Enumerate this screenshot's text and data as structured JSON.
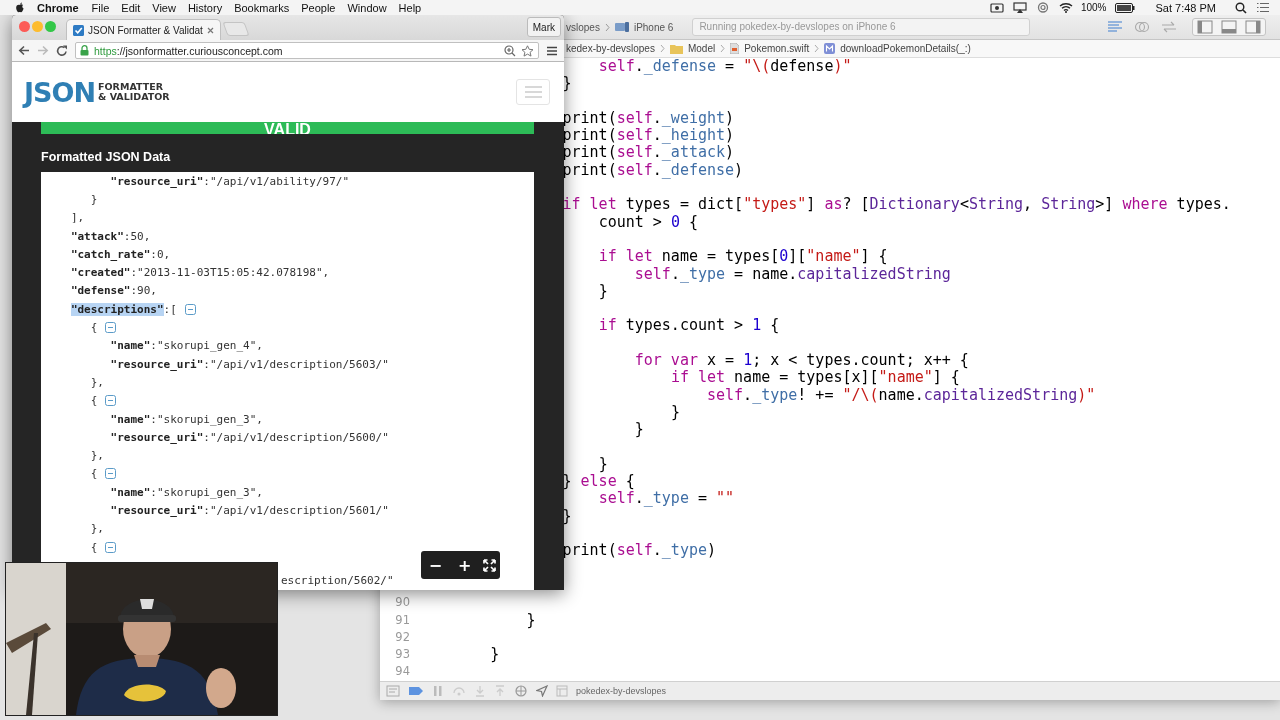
{
  "menu_bar": {
    "app": "Chrome",
    "items": [
      "File",
      "Edit",
      "View",
      "History",
      "Bookmarks",
      "People",
      "Window",
      "Help"
    ],
    "battery": "100%",
    "clock": "Sat 7:48 PM"
  },
  "xcode": {
    "toolbar": {
      "scheme": "vslopes",
      "device": "iPhone 6",
      "status": "Running pokedex-by-devslopes on iPhone 6"
    },
    "breadcrumbs": [
      {
        "kind": "project",
        "label": "kedex-by-devslopes"
      },
      {
        "kind": "folder",
        "label": "Model"
      },
      {
        "kind": "file",
        "label": "Pokemon.swift"
      },
      {
        "kind": "method",
        "label": "downloadPokemonDetails(_:)"
      }
    ],
    "lines": [
      {
        "kind": "code",
        "tokens": [
          {
            "kind": "keyword",
            "text": "                    self"
          },
          {
            "kind": "plain",
            "text": "."
          },
          {
            "kind": "member",
            "text": "_defense"
          },
          {
            "kind": "plain",
            "text": " = "
          },
          {
            "kind": "string",
            "text": "\"\\("
          },
          {
            "kind": "plain",
            "text": "defense"
          },
          {
            "kind": "string",
            "text": ")\""
          }
        ]
      },
      {
        "kind": "code",
        "tokens": [
          {
            "kind": "plain",
            "text": "                }"
          }
        ]
      },
      {
        "kind": "blank"
      },
      {
        "kind": "code",
        "tokens": [
          {
            "kind": "plain",
            "text": "                print("
          },
          {
            "kind": "keyword",
            "text": "self"
          },
          {
            "kind": "plain",
            "text": "."
          },
          {
            "kind": "member",
            "text": "_weight"
          },
          {
            "kind": "plain",
            "text": ")"
          }
        ]
      },
      {
        "kind": "code",
        "tokens": [
          {
            "kind": "plain",
            "text": "                print("
          },
          {
            "kind": "keyword",
            "text": "self"
          },
          {
            "kind": "plain",
            "text": "."
          },
          {
            "kind": "member",
            "text": "_height"
          },
          {
            "kind": "plain",
            "text": ")"
          }
        ]
      },
      {
        "kind": "code",
        "tokens": [
          {
            "kind": "plain",
            "text": "                print("
          },
          {
            "kind": "keyword",
            "text": "self"
          },
          {
            "kind": "plain",
            "text": "."
          },
          {
            "kind": "member",
            "text": "_attack"
          },
          {
            "kind": "plain",
            "text": ")"
          }
        ]
      },
      {
        "kind": "code",
        "tokens": [
          {
            "kind": "plain",
            "text": "                print("
          },
          {
            "kind": "keyword",
            "text": "self"
          },
          {
            "kind": "plain",
            "text": "."
          },
          {
            "kind": "member",
            "text": "_defense"
          },
          {
            "kind": "plain",
            "text": ")"
          }
        ]
      },
      {
        "kind": "blank"
      },
      {
        "kind": "code",
        "tokens": [
          {
            "kind": "keyword",
            "text": "                if let"
          },
          {
            "kind": "plain",
            "text": " types = dict["
          },
          {
            "kind": "string",
            "text": "\"types\""
          },
          {
            "kind": "plain",
            "text": "] "
          },
          {
            "kind": "keyword",
            "text": "as"
          },
          {
            "kind": "plain",
            "text": "? ["
          },
          {
            "kind": "type",
            "text": "Dictionary"
          },
          {
            "kind": "plain",
            "text": "<"
          },
          {
            "kind": "type",
            "text": "String"
          },
          {
            "kind": "plain",
            "text": ", "
          },
          {
            "kind": "type",
            "text": "String"
          },
          {
            "kind": "plain",
            "text": ">] "
          },
          {
            "kind": "keyword",
            "text": "where"
          },
          {
            "kind": "plain",
            "text": " types."
          }
        ]
      },
      {
        "kind": "code",
        "tokens": [
          {
            "kind": "plain",
            "text": "                    count > "
          },
          {
            "kind": "number",
            "text": "0"
          },
          {
            "kind": "plain",
            "text": " {"
          }
        ]
      },
      {
        "kind": "blank"
      },
      {
        "kind": "code",
        "tokens": [
          {
            "kind": "keyword",
            "text": "                    if let"
          },
          {
            "kind": "plain",
            "text": " name = types["
          },
          {
            "kind": "number",
            "text": "0"
          },
          {
            "kind": "plain",
            "text": "]["
          },
          {
            "kind": "string",
            "text": "\"name\""
          },
          {
            "kind": "plain",
            "text": "] {"
          }
        ]
      },
      {
        "kind": "code",
        "tokens": [
          {
            "kind": "keyword",
            "text": "                        self"
          },
          {
            "kind": "plain",
            "text": "."
          },
          {
            "kind": "member",
            "text": "_type"
          },
          {
            "kind": "plain",
            "text": " = name."
          },
          {
            "kind": "type",
            "text": "capitalizedString"
          }
        ]
      },
      {
        "kind": "code",
        "tokens": [
          {
            "kind": "plain",
            "text": "                    }"
          }
        ]
      },
      {
        "kind": "blank"
      },
      {
        "kind": "code",
        "tokens": [
          {
            "kind": "keyword",
            "text": "                    if"
          },
          {
            "kind": "plain",
            "text": " types.count > "
          },
          {
            "kind": "number",
            "text": "1"
          },
          {
            "kind": "plain",
            "text": " {"
          }
        ]
      },
      {
        "kind": "blank"
      },
      {
        "kind": "code",
        "tokens": [
          {
            "kind": "keyword",
            "text": "                        for var"
          },
          {
            "kind": "plain",
            "text": " x = "
          },
          {
            "kind": "number",
            "text": "1"
          },
          {
            "kind": "plain",
            "text": "; x < types.count; x++ {"
          }
        ]
      },
      {
        "kind": "code",
        "tokens": [
          {
            "kind": "keyword",
            "text": "                            if let"
          },
          {
            "kind": "plain",
            "text": " name = types[x]["
          },
          {
            "kind": "string",
            "text": "\"name\""
          },
          {
            "kind": "plain",
            "text": "] {"
          }
        ]
      },
      {
        "kind": "code",
        "tokens": [
          {
            "kind": "keyword",
            "text": "                                self"
          },
          {
            "kind": "plain",
            "text": "."
          },
          {
            "kind": "member",
            "text": "_type"
          },
          {
            "kind": "plain",
            "text": "! += "
          },
          {
            "kind": "string",
            "text": "\"/\\("
          },
          {
            "kind": "plain",
            "text": "name."
          },
          {
            "kind": "type",
            "text": "capitalizedString"
          },
          {
            "kind": "string",
            "text": ")\""
          }
        ]
      },
      {
        "kind": "code",
        "tokens": [
          {
            "kind": "plain",
            "text": "                            }"
          }
        ]
      },
      {
        "kind": "code",
        "tokens": [
          {
            "kind": "plain",
            "text": "                        }"
          }
        ]
      },
      {
        "kind": "blank"
      },
      {
        "kind": "code",
        "tokens": [
          {
            "kind": "plain",
            "text": "                    }"
          }
        ]
      },
      {
        "kind": "code",
        "tokens": [
          {
            "kind": "plain",
            "text": "                } "
          },
          {
            "kind": "keyword",
            "text": "else"
          },
          {
            "kind": "plain",
            "text": " {"
          }
        ]
      },
      {
        "kind": "code",
        "tokens": [
          {
            "kind": "keyword",
            "text": "                    self"
          },
          {
            "kind": "plain",
            "text": "."
          },
          {
            "kind": "member",
            "text": "_type"
          },
          {
            "kind": "plain",
            "text": " = "
          },
          {
            "kind": "string",
            "text": "\"\""
          }
        ]
      },
      {
        "kind": "code",
        "tokens": [
          {
            "kind": "plain",
            "text": "                }"
          }
        ]
      },
      {
        "kind": "blank"
      },
      {
        "kind": "code",
        "tokens": [
          {
            "kind": "plain",
            "text": "                print("
          },
          {
            "kind": "keyword",
            "text": "self"
          },
          {
            "kind": "plain",
            "text": "."
          },
          {
            "kind": "member",
            "text": "_type"
          },
          {
            "kind": "plain",
            "text": ")"
          }
        ]
      },
      {
        "kind": "blank"
      },
      {
        "kind": "blank"
      },
      {
        "kind": "blank",
        "number": "90"
      },
      {
        "kind": "code",
        "number": "91",
        "tokens": [
          {
            "kind": "plain",
            "text": "            }"
          }
        ]
      },
      {
        "kind": "blank",
        "number": "92"
      },
      {
        "kind": "code",
        "number": "93",
        "tokens": [
          {
            "kind": "plain",
            "text": "        }"
          }
        ]
      },
      {
        "kind": "blank",
        "number": "94"
      }
    ],
    "debug_bar": {
      "target": "pokedex-by-devslopes"
    }
  },
  "chrome": {
    "tab": {
      "title": "JSON Formatter & Validat"
    },
    "profile": "Mark",
    "url": {
      "scheme": "https",
      "rest": "://jsonformatter.curiousconcept.com"
    },
    "page": {
      "logo": {
        "main": "JSON",
        "line_1": "FORMATTER",
        "line_2": "& VALIDATOR"
      },
      "status": "VALID",
      "section_title": "Formatted JSON Data",
      "json_lines": [
        {
          "key": "         \"resource_uri\"",
          "value": ":\"/api/v1/ability/97/\"",
          "selected": false
        },
        {
          "value": "      }",
          "selected": false
        },
        {
          "value": "   ],",
          "selected": false
        },
        {
          "key": "   \"attack\"",
          "value": ":50,",
          "selected": false
        },
        {
          "key": "   \"catch_rate\"",
          "value": ":0,",
          "selected": false
        },
        {
          "key": "   \"created\"",
          "value": ":\"2013-11-03T15:05:42.078198\",",
          "selected": false
        },
        {
          "key": "   \"defense\"",
          "value": ":90,",
          "selected": false
        },
        {
          "key": "   \"descriptions\"",
          "value": ":[",
          "selected": true,
          "expanded": true
        },
        {
          "value": "      {",
          "selected": false,
          "expanded": true
        },
        {
          "key": "         \"name\"",
          "value": ":\"skorupi_gen_4\",",
          "selected": false
        },
        {
          "key": "         \"resource_uri\"",
          "value": ":\"/api/v1/description/5603/\"",
          "selected": false
        },
        {
          "value": "      },",
          "selected": false
        },
        {
          "value": "      {",
          "selected": false,
          "expanded": true
        },
        {
          "key": "         \"name\"",
          "value": ":\"skorupi_gen_3\",",
          "selected": false
        },
        {
          "key": "         \"resource_uri\"",
          "value": ":\"/api/v1/description/5600/\"",
          "selected": false
        },
        {
          "value": "      },",
          "selected": false
        },
        {
          "value": "      {",
          "selected": false,
          "expanded": true
        },
        {
          "key": "         \"name\"",
          "value": ":\"skorupi_gen_3\",",
          "selected": false
        },
        {
          "key": "         \"resource_uri\"",
          "value": ":\"/api/v1/description/5601/\"",
          "selected": false
        },
        {
          "value": "      },",
          "selected": false
        },
        {
          "value": "      {",
          "selected": false,
          "expanded": true
        }
      ],
      "partial_line": "escription/5602/\"",
      "zoom_controls": [
        "−",
        "+"
      ]
    }
  }
}
